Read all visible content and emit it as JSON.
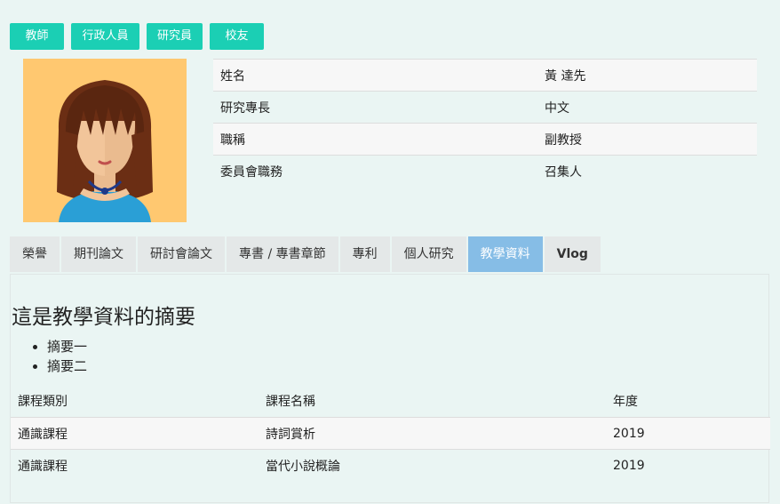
{
  "role_tabs": [
    "教師",
    "行政人員",
    "研究員",
    "校友"
  ],
  "profile": {
    "rows": [
      {
        "key": "姓名",
        "value": "黃 達先"
      },
      {
        "key": "研究專長",
        "value": "中文"
      },
      {
        "key": "職稱",
        "value": "副教授"
      },
      {
        "key": "委員會職務",
        "value": "召集人"
      }
    ],
    "colors": {
      "avatar_bg": "#ffc870"
    }
  },
  "tabs": [
    {
      "label": "榮譽"
    },
    {
      "label": "期刊論文"
    },
    {
      "label": "研討會論文"
    },
    {
      "label": "專書 / 專書章節"
    },
    {
      "label": "專利"
    },
    {
      "label": "個人研究"
    },
    {
      "label": "教學資料",
      "active": true
    },
    {
      "label": "Vlog"
    }
  ],
  "teaching": {
    "summary_title": "這是教學資料的摘要",
    "summary_items": [
      "摘要一",
      "摘要二"
    ],
    "columns": [
      "課程類別",
      "課程名稱",
      "年度"
    ],
    "rows": [
      [
        "通識課程",
        "詩詞賞析",
        "2019"
      ],
      [
        "通識課程",
        "當代小說概論",
        "2019"
      ]
    ]
  },
  "colors": {
    "accent": "#1bcfb4",
    "active_tab": "#86bde6",
    "background": "#eaf5f3"
  }
}
